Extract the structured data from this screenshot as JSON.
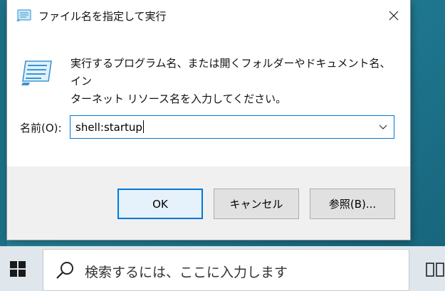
{
  "dialog": {
    "title": "ファイル名を指定して実行",
    "description_line1": "実行するプログラム名、または開くフォルダーやドキュメント名、イン",
    "description_line2": "ターネット リソース名を入力してください。",
    "name_label": "名前(O):",
    "command_value": "shell:startup",
    "ok_label": "OK",
    "cancel_label": "キャンセル",
    "browse_label": "参照(B)..."
  },
  "taskbar": {
    "search_placeholder": "検索するには、ここに入力します"
  },
  "colors": {
    "accent": "#0078d7",
    "desktop": "#1f7890",
    "taskbar": "#dfe6ec"
  },
  "icons": [
    "run-icon",
    "close-icon",
    "chevron-down-icon",
    "windows-logo-icon",
    "search-icon",
    "task-view-icon"
  ]
}
